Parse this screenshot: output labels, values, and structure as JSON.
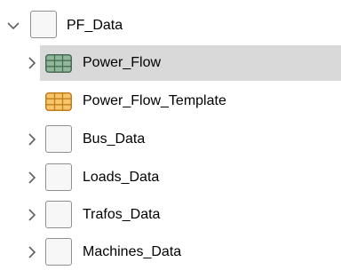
{
  "tree": {
    "root": {
      "label": "PF_Data",
      "expanded": true,
      "icon": "folder-icon"
    },
    "children": [
      {
        "label": "Power_Flow",
        "icon": "table-icon-green",
        "expandable": true,
        "selected": true
      },
      {
        "label": "Power_Flow_Template",
        "icon": "table-icon-orange",
        "expandable": false,
        "selected": false
      },
      {
        "label": "Bus_Data",
        "icon": "folder-icon",
        "expandable": true,
        "selected": false
      },
      {
        "label": "Loads_Data",
        "icon": "folder-icon",
        "expandable": true,
        "selected": false
      },
      {
        "label": "Trafos_Data",
        "icon": "folder-icon",
        "expandable": true,
        "selected": false
      },
      {
        "label": "Machines_Data",
        "icon": "folder-icon",
        "expandable": true,
        "selected": false
      }
    ]
  },
  "colors": {
    "selection": "#d9d9d9",
    "table_green_fill": "#8fb89a",
    "table_green_border": "#4a6b55",
    "table_orange_fill": "#f8c56a",
    "table_orange_border": "#c07d1a",
    "chevron": "#606060",
    "folder_border": "#8f8f8f"
  }
}
